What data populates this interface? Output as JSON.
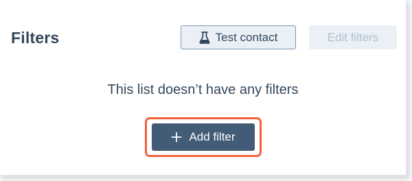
{
  "header": {
    "title": "Filters",
    "test_contact_label": "Test contact",
    "test_contact_icon": "flask-icon",
    "edit_filters_label": "Edit filters"
  },
  "empty_state": {
    "message": "This list doesn’t have any filters",
    "add_filter_label": "Add filter",
    "add_filter_icon": "plus-icon"
  },
  "colors": {
    "primary_button": "#425b76",
    "highlight_border": "#f2613c",
    "text": "#33475b",
    "disabled_text": "#b0c1d4"
  }
}
